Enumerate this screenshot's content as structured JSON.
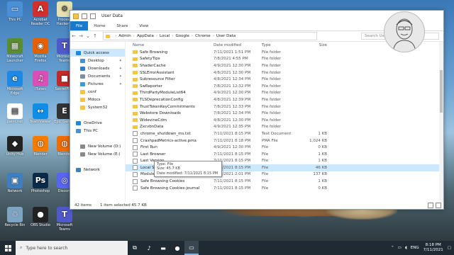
{
  "desktop": {
    "icons": [
      {
        "label": "This PC",
        "color": "#4a90d9",
        "glyph": "▭"
      },
      {
        "label": "Acrobat Reader DC",
        "color": "#d32f2f",
        "glyph": "A"
      },
      {
        "label": "Process Hacker 2",
        "color": "#e8e0b0",
        "glyph": "⚙"
      },
      {
        "label": "Minecraft Launcher",
        "color": "#5b8c32",
        "glyph": "▦"
      },
      {
        "label": "Mozilla Firefox",
        "color": "#e66000",
        "glyph": "◉"
      },
      {
        "label": "Microsoft Teams",
        "color": "#5059c9",
        "glyph": "T"
      },
      {
        "label": "Microsoft Edge",
        "color": "#1e88e5",
        "glyph": "e"
      },
      {
        "label": "iTunes",
        "color": "#d94fb5",
        "glyph": "♫"
      },
      {
        "label": "SecretFiles",
        "color": "#c62828",
        "glyph": "■"
      },
      {
        "label": "paint.net",
        "color": "#ffffff",
        "glyph": "▤"
      },
      {
        "label": "TeamViewer",
        "color": "#0e8ee9",
        "glyph": "↔"
      },
      {
        "label": "Epic Games",
        "color": "#333333",
        "glyph": "E"
      },
      {
        "label": "Unity Hub",
        "color": "#222222",
        "glyph": "◆"
      },
      {
        "label": "Blender",
        "color": "#f57c00",
        "glyph": "◍"
      },
      {
        "label": "Blender",
        "color": "#ef6c00",
        "glyph": "◍"
      },
      {
        "label": "Network",
        "color": "#3f7fbf",
        "glyph": "▣"
      },
      {
        "label": "Photoshop",
        "color": "#0b2a4a",
        "glyph": "Ps"
      },
      {
        "label": "Discord",
        "color": "#5865f2",
        "glyph": "◎"
      },
      {
        "label": "Recycle Bin",
        "color": "#7ea4c4",
        "glyph": "♲"
      },
      {
        "label": "OBS Studio",
        "color": "#222222",
        "glyph": "●"
      },
      {
        "label": "Microsoft Teams",
        "color": "#5059c9",
        "glyph": "T"
      }
    ]
  },
  "window": {
    "title": "User Data",
    "ribbon_tabs": [
      "File",
      "Home",
      "Share",
      "View"
    ],
    "address": [
      "Admin",
      "AppData",
      "Local",
      "Google",
      "Chrome",
      "User Data"
    ],
    "search_placeholder": "Search User Data",
    "nav": [
      {
        "label": "Quick access",
        "color": "#1e88e5",
        "pinned": false,
        "selected": true
      },
      {
        "label": "Desktop",
        "color": "#4a90d9",
        "pinned": true,
        "selected": false
      },
      {
        "label": "Downloads",
        "color": "#2e7dd1",
        "pinned": true,
        "selected": false
      },
      {
        "label": "Documents",
        "color": "#7d8fa3",
        "pinned": true,
        "selected": false
      },
      {
        "label": "Pictures",
        "color": "#3a9bdc",
        "pinned": true,
        "selected": false
      },
      {
        "label": "conf",
        "color": "#f4c542",
        "pinned": false,
        "selected": false
      },
      {
        "label": "Mdocs",
        "color": "#f4c542",
        "pinned": false,
        "selected": false
      },
      {
        "label": "System32",
        "color": "#f4c542",
        "pinned": false,
        "selected": false
      },
      {
        "label": "",
        "color": "",
        "pinned": false,
        "selected": false
      },
      {
        "label": "OneDrive",
        "color": "#1e88e5",
        "pinned": false,
        "selected": false
      },
      {
        "label": "This PC",
        "color": "#4a90d9",
        "pinned": false,
        "selected": false
      },
      {
        "label": "",
        "color": "",
        "pinned": false,
        "selected": false
      },
      {
        "label": "New Volume (D:)",
        "color": "#888888",
        "pinned": false,
        "selected": false
      },
      {
        "label": "New Volume (E:)",
        "color": "#888888",
        "pinned": false,
        "selected": false
      },
      {
        "label": "",
        "color": "",
        "pinned": false,
        "selected": false
      },
      {
        "label": "Network",
        "color": "#3f7fbf",
        "pinned": false,
        "selected": false
      }
    ],
    "columns": {
      "name": "Name",
      "date": "Date modified",
      "type": "Type",
      "size": "Size"
    },
    "files": [
      {
        "name": "Safe Browsing",
        "date": "7/11/2021 1:51 PM",
        "type": "File folder",
        "size": "",
        "kind": "folder"
      },
      {
        "name": "SafetyTips",
        "date": "7/8/2021 4:55 PM",
        "type": "File folder",
        "size": "",
        "kind": "folder"
      },
      {
        "name": "ShaderCache",
        "date": "4/9/2021 12:30 PM",
        "type": "File folder",
        "size": "",
        "kind": "folder"
      },
      {
        "name": "SSLErrorAssistant",
        "date": "4/8/2021 12:30 PM",
        "type": "File folder",
        "size": "",
        "kind": "folder"
      },
      {
        "name": "Subresource Filter",
        "date": "4/8/2021 12:34 PM",
        "type": "File folder",
        "size": "",
        "kind": "folder"
      },
      {
        "name": "SwReporter",
        "date": "7/8/2021 12:32 PM",
        "type": "File folder",
        "size": "",
        "kind": "folder"
      },
      {
        "name": "ThirdPartyModuleList64",
        "date": "4/9/2021 12:30 PM",
        "type": "File folder",
        "size": "",
        "kind": "folder"
      },
      {
        "name": "TLSDeprecationConfig",
        "date": "4/8/2021 12:39 PM",
        "type": "File folder",
        "size": "",
        "kind": "folder"
      },
      {
        "name": "TrustTokenKeyCommitments",
        "date": "7/8/2021 12:33 PM",
        "type": "File folder",
        "size": "",
        "kind": "folder"
      },
      {
        "name": "Webstore Downloads",
        "date": "7/8/2021 12:34 PM",
        "type": "File folder",
        "size": "",
        "kind": "folder"
      },
      {
        "name": "WidevineCdm",
        "date": "4/8/2021 12:30 PM",
        "type": "File folder",
        "size": "",
        "kind": "folder"
      },
      {
        "name": "ZxcvbnData",
        "date": "4/9/2021 12:35 PM",
        "type": "File folder",
        "size": "",
        "kind": "folder"
      },
      {
        "name": "chrome_shutdown_ms.txt",
        "date": "7/11/2021 8:15 PM",
        "type": "Text Document",
        "size": "1 KB",
        "kind": "file"
      },
      {
        "name": "CrashpadMetrics-active.pma",
        "date": "7/11/2021 8:18 PM",
        "type": "PMA File",
        "size": "1,024 KB",
        "kind": "file"
      },
      {
        "name": "First Run",
        "date": "4/9/2021 12:30 PM",
        "type": "File",
        "size": "0 KB",
        "kind": "file"
      },
      {
        "name": "Last Browser",
        "date": "7/11/2021 8:15 PM",
        "type": "File",
        "size": "1 KB",
        "kind": "file"
      },
      {
        "name": "Last Version",
        "date": "7/11/2021 8:15 PM",
        "type": "File",
        "size": "1 KB",
        "kind": "file"
      },
      {
        "name": "Local State",
        "date": "7/11/2021 8:15 PM",
        "type": "File",
        "size": "46 KB",
        "kind": "file",
        "hover": true
      },
      {
        "name": "Module Info Cache",
        "date": "7/11/2021 2:01 PM",
        "type": "File",
        "size": "137 KB",
        "kind": "file"
      },
      {
        "name": "Safe Browsing Cookies",
        "date": "7/11/2021 8:15 PM",
        "type": "File",
        "size": "1 KB",
        "kind": "file"
      },
      {
        "name": "Safe Browsing Cookies-journal",
        "date": "7/11/2021 8:15 PM",
        "type": "File",
        "size": "0 KB",
        "kind": "file"
      }
    ],
    "tooltip": {
      "type": "Type: File",
      "size": "Size: 45.7 KB",
      "modified": "Date modified: 7/11/2021 8:15 PM"
    },
    "status": {
      "items": "42 items",
      "selected": "1 item selected  45.7 KB"
    }
  },
  "taskbar": {
    "search_placeholder": "Type here to search",
    "icons": [
      {
        "name": "task-view-icon",
        "glyph": "⧉",
        "active": false
      },
      {
        "name": "media-player-icon",
        "glyph": "♪",
        "active": false
      },
      {
        "name": "red-app-icon",
        "glyph": "▬",
        "active": false
      },
      {
        "name": "obs-icon",
        "glyph": "●",
        "active": false
      },
      {
        "name": "file-explorer-icon",
        "glyph": "▭",
        "active": true
      }
    ],
    "tray_lang": "ENG",
    "time": "8:18 PM",
    "date": "7/11/2021"
  }
}
